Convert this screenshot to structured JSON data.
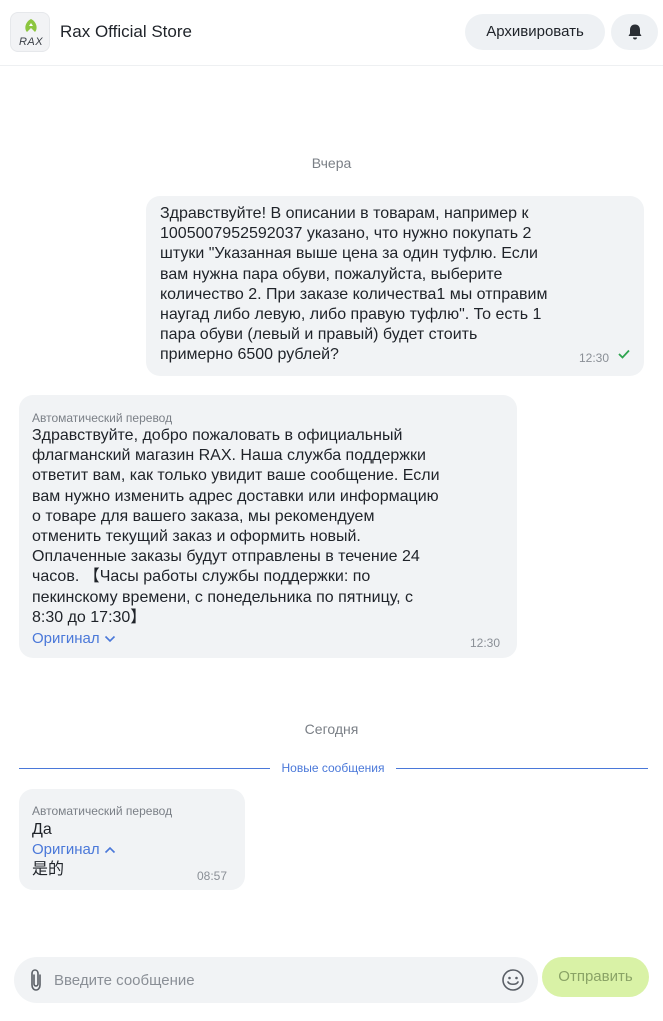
{
  "header": {
    "store_name": "Rax Official Store",
    "logo_text": "RAX",
    "archive_label": "Архивировать",
    "bell_icon": "bell-icon"
  },
  "chat": {
    "date_yesterday": "Вчера",
    "date_today": "Сегодня",
    "new_messages_label": "Новые сообщения",
    "messages": [
      {
        "direction": "outgoing",
        "lines": [
          "Здравствуйте! В описании в товарам, например к",
          "1005007952592037 указано, что нужно покупать 2",
          "штуки \"Указанная выше цена за один туфлю. Если",
          "вам нужна пара обуви, пожалуйста, выберите",
          "количество 2. При заказе количества1 мы отправим",
          "наугад либо левую, либо правую туфлю\". То есть 1",
          "пара обуви (левый и правый) будет стоить",
          "примерно 6500 рублей?"
        ],
        "time": "12:30",
        "read_icon": "check-icon"
      },
      {
        "direction": "incoming",
        "auto_label": "Автоматический перевод",
        "lines": [
          "Здравствуйте, добро пожаловать в официальный",
          "флагманский магазин RAX. Наша служба поддержки",
          "ответит вам, как только увидит ваше сообщение. Если",
          "вам нужно изменить адрес доставки или информацию",
          "о товаре для вашего заказа, мы рекомендуем",
          "отменить текущий заказ и оформить новый.",
          "Оплаченные заказы будут отправлены в течение 24",
          "часов. 【Часы работы службы поддержки: по",
          "пекинскому времени, с понедельника по пятницу, с",
          "8:30 до 17:30】"
        ],
        "original_label": "Оригинал",
        "time": "12:30"
      },
      {
        "direction": "incoming",
        "auto_label": "Автоматический перевод",
        "text": "Да",
        "original_label": "Оригинал",
        "original_text": "是的",
        "time": "08:57"
      }
    ]
  },
  "composer": {
    "placeholder": "Введите сообщение",
    "send_label": "Отправить",
    "attach_icon": "paperclip-icon",
    "emoji_icon": "emoji-icon"
  },
  "colors": {
    "accent": "#4a78d9",
    "bubble": "#f1f3f5",
    "send_button": "#d9f2a6",
    "read_check": "#2ea44f"
  }
}
